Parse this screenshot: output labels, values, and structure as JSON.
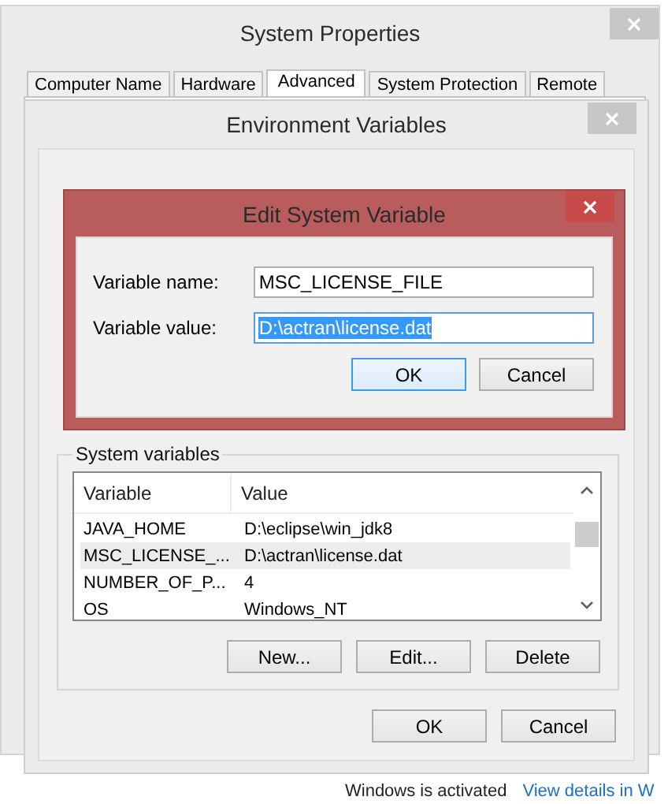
{
  "system_properties": {
    "title": "System Properties",
    "tabs": [
      {
        "label": "Computer Name",
        "selected": false
      },
      {
        "label": "Hardware",
        "selected": false
      },
      {
        "label": "Advanced",
        "selected": true
      },
      {
        "label": "System Protection",
        "selected": false
      },
      {
        "label": "Remote",
        "selected": false
      }
    ]
  },
  "environment_variables": {
    "title": "Environment Variables",
    "system_variables": {
      "label": "System variables",
      "columns": [
        "Variable",
        "Value"
      ],
      "rows": [
        {
          "variable": "JAVA_HOME",
          "value": "D:\\eclipse\\win_jdk8",
          "selected": false
        },
        {
          "variable": "MSC_LICENSE_...",
          "value": "D:\\actran\\license.dat",
          "selected": true
        },
        {
          "variable": "NUMBER_OF_P...",
          "value": "4",
          "selected": false
        },
        {
          "variable": "OS",
          "value": "Windows_NT",
          "selected": false
        }
      ],
      "buttons": [
        "New...",
        "Edit...",
        "Delete"
      ]
    },
    "buttons": [
      "OK",
      "Cancel"
    ]
  },
  "edit_dialog": {
    "title": "Edit System Variable",
    "fields": [
      {
        "label": "Variable name:",
        "value": "MSC_LICENSE_FILE",
        "selected": false
      },
      {
        "label": "Variable value:",
        "value": "D:\\actran\\license.dat",
        "selected": true
      }
    ],
    "buttons": [
      {
        "label": "OK",
        "default": true
      },
      {
        "label": "Cancel",
        "default": false
      }
    ]
  },
  "activation": {
    "text": "Windows is activated",
    "link": "View details in W"
  }
}
